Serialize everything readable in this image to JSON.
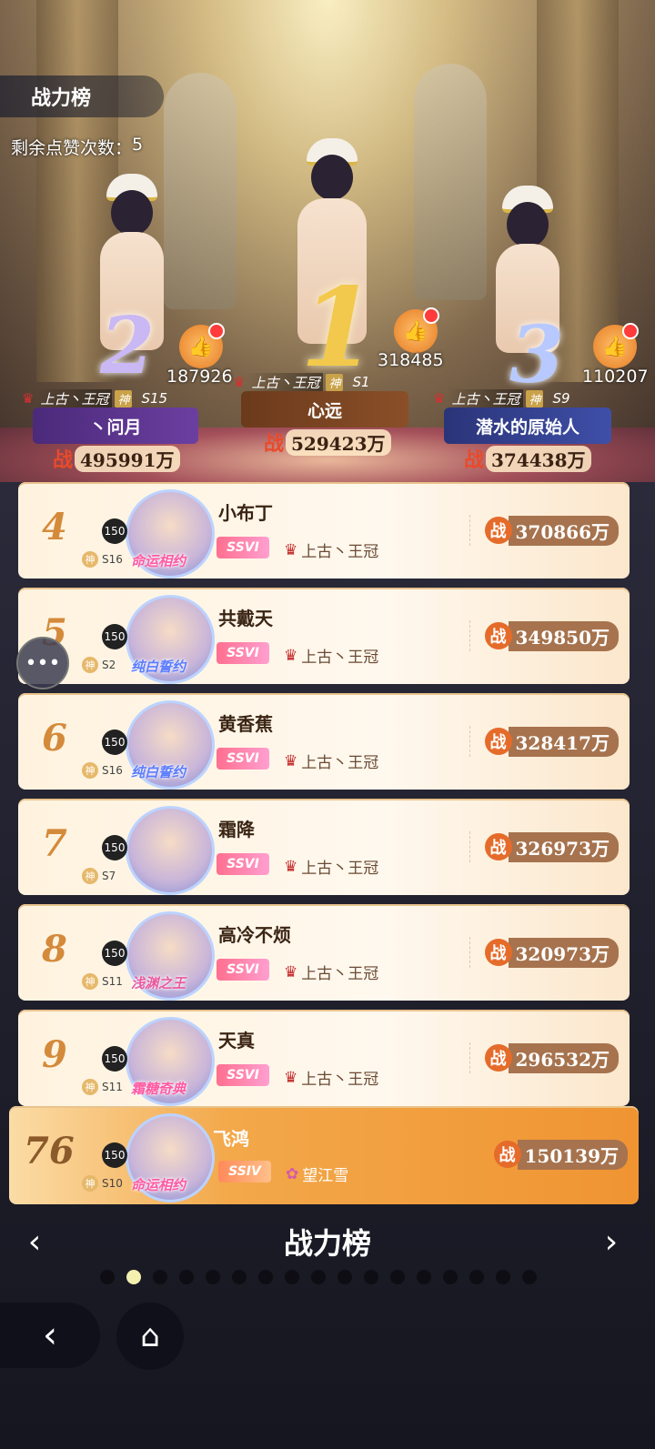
{
  "header": {
    "title": "战力榜",
    "likes_label": "剩余点赞次数：",
    "likes_remaining": "5"
  },
  "podium": [
    {
      "rank": "2",
      "likes": "187926",
      "guild": "上古丶王冠",
      "shen": "神",
      "server": "S15",
      "name": "丶问月",
      "power_label": "战",
      "power": "495991万"
    },
    {
      "rank": "1",
      "likes": "318485",
      "guild": "上古丶王冠",
      "shen": "神",
      "server": "S1",
      "name": "心远",
      "power_label": "战",
      "power": "529423万"
    },
    {
      "rank": "3",
      "likes": "110207",
      "guild": "上古丶王冠",
      "shen": "神",
      "server": "S9",
      "name": "潜水的原始人",
      "power_label": "战",
      "power": "374438万"
    }
  ],
  "rows": [
    {
      "rank": "4",
      "level": "150",
      "shen": "神",
      "server": "S16",
      "badge": "命运相约",
      "name": "小布丁",
      "vip": "SSVI",
      "guild": "上古丶王冠",
      "power_label": "战",
      "power": "370866万"
    },
    {
      "rank": "5",
      "level": "150",
      "shen": "神",
      "server": "S2",
      "badge": "纯白誓约",
      "name": "共戴天",
      "vip": "SSVI",
      "guild": "上古丶王冠",
      "power_label": "战",
      "power": "349850万"
    },
    {
      "rank": "6",
      "level": "150",
      "shen": "神",
      "server": "S16",
      "badge": "纯白誓约",
      "name": "黄香蕉",
      "vip": "SSVI",
      "guild": "上古丶王冠",
      "power_label": "战",
      "power": "328417万"
    },
    {
      "rank": "7",
      "level": "150",
      "shen": "神",
      "server": "S7",
      "badge": "",
      "name": "霜降",
      "vip": "SSVI",
      "guild": "上古丶王冠",
      "power_label": "战",
      "power": "326973万"
    },
    {
      "rank": "8",
      "level": "150",
      "shen": "神",
      "server": "S11",
      "badge": "浅渊之王",
      "name": "高冷不烦",
      "vip": "SSVI",
      "guild": "上古丶王冠",
      "power_label": "战",
      "power": "320973万"
    },
    {
      "rank": "9",
      "level": "150",
      "shen": "神",
      "server": "S11",
      "badge": "霜糖奇典",
      "name": "天真",
      "vip": "SSVI",
      "guild": "上古丶王冠",
      "power_label": "战",
      "power": "296532万"
    }
  ],
  "me": {
    "rank": "76",
    "level": "150",
    "shen": "神",
    "server": "S10",
    "badge": "命运相约",
    "name": "飞鸿",
    "vip": "SSIV",
    "guild": "望江雪",
    "power_label": "战",
    "power": "150139万"
  },
  "footer": {
    "title": "战力榜",
    "prev_icon": "‹",
    "next_icon": "›",
    "back_icon": "‹",
    "home_icon": "⌂",
    "chat_icon": "•••"
  },
  "colors": {
    "accent": "#e56b2a",
    "rank_gold": "#d48a3b"
  }
}
